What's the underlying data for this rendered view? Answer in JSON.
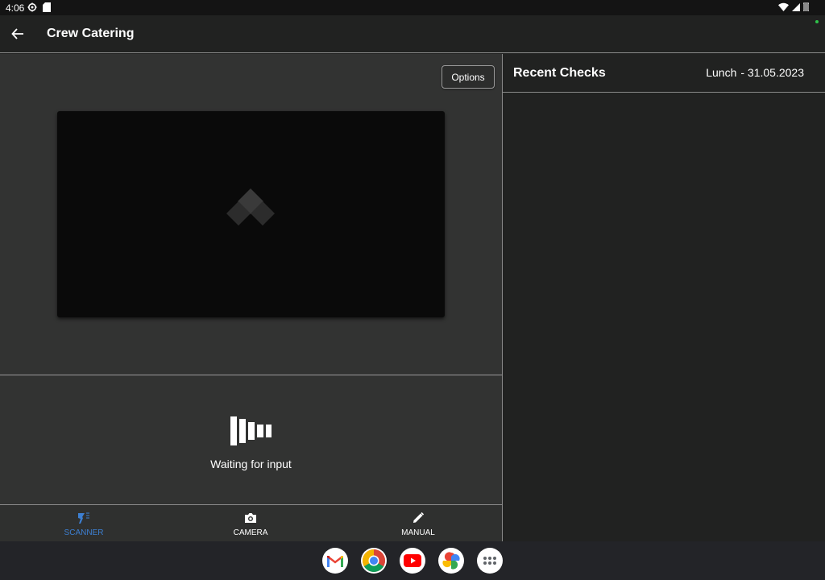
{
  "status_bar": {
    "time": "4:06",
    "icons": [
      "gear-icon",
      "sd-card-icon",
      "wifi-icon",
      "signal-icon",
      "battery-icon"
    ]
  },
  "app_bar": {
    "title": "Crew Catering",
    "back_icon": "arrow-left-icon",
    "indicator_color": "#2ec24a"
  },
  "scanner_panel": {
    "options_label": "Options",
    "status_text": "Waiting for input",
    "status_icon": "barcode-waiting-icon"
  },
  "bottom_nav": {
    "items": [
      {
        "label": "SCANNER",
        "icon": "scanner-icon",
        "active": true
      },
      {
        "label": "CAMERA",
        "icon": "camera-icon",
        "active": false
      },
      {
        "label": "MANUAL",
        "icon": "pencil-icon",
        "active": false
      }
    ],
    "active_color": "#3d7fd1"
  },
  "recent_checks": {
    "title": "Recent Checks",
    "meal": "Lunch",
    "date": "- 31.05.2023"
  },
  "taskbar": {
    "apps": [
      "gmail-icon",
      "chrome-icon",
      "youtube-icon",
      "photos-icon",
      "app-drawer-icon"
    ]
  }
}
